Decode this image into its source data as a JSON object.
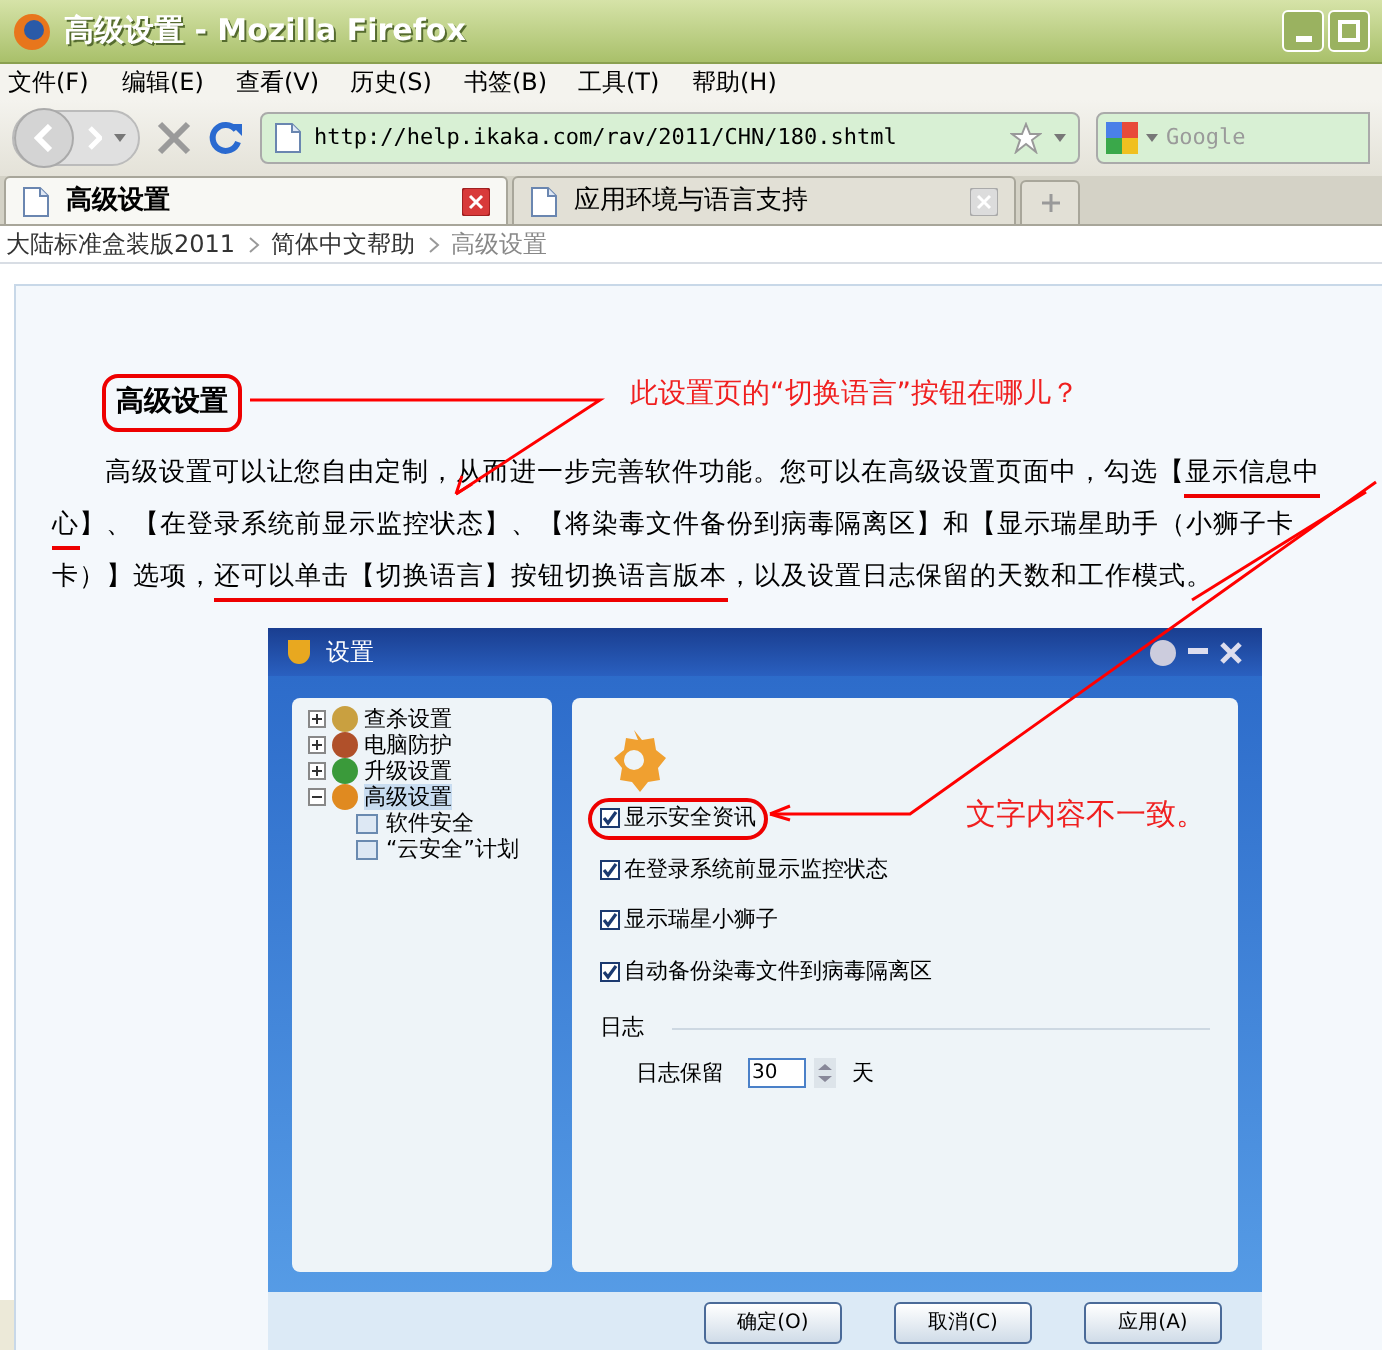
{
  "window": {
    "title": "高级设置 - Mozilla Firefox"
  },
  "menu": [
    "文件(F)",
    "编辑(E)",
    "查看(V)",
    "历史(S)",
    "书签(B)",
    "工具(T)",
    "帮助(H)"
  ],
  "toolbar": {
    "url": "http://help.ikaka.com/rav/2011/CHN/180.shtml",
    "search_placeholder": "Google"
  },
  "tabs": [
    {
      "label": "高级设置",
      "selected": true
    },
    {
      "label": "应用环境与语言支持",
      "selected": false
    }
  ],
  "breadcrumb": [
    {
      "label": "大陆标准盒装版2011",
      "current": false
    },
    {
      "label": "简体中文帮助",
      "current": false
    },
    {
      "label": "高级设置",
      "current": true
    }
  ],
  "article": {
    "heading": "高级设置",
    "paragraph": [
      {
        "text": "高级设置可以让您自由定制，从而进一步完善软件功能。您可以在高级设置页面中，勾选【",
        "underlined": false
      },
      {
        "text": "显示信息中心",
        "underlined": true
      },
      {
        "text": "】、【在登录系统前显示监控状态】、【将染毒文件备份到病毒隔离区】和【显示瑞星助手（小狮子卡卡）】选项，",
        "underlined": false
      },
      {
        "text": "还可以单击【切换语言】按钮切换语言版本",
        "underlined": true
      },
      {
        "text": "，以及设置日志保留的天数和工作模式。",
        "underlined": false
      }
    ]
  },
  "annotations": [
    "此设置页的“切换语言”按钮在哪儿？",
    "文字内容不一致。"
  ],
  "dialog": {
    "title": "设置",
    "tree": [
      {
        "label": "查杀设置",
        "expanded": false,
        "selected": false
      },
      {
        "label": "电脑防护",
        "expanded": false,
        "selected": false
      },
      {
        "label": "升级设置",
        "expanded": false,
        "selected": false
      },
      {
        "label": "高级设置",
        "expanded": true,
        "selected": true,
        "children": [
          {
            "label": "软件安全"
          },
          {
            "label": "“云安全”计划"
          }
        ]
      }
    ],
    "options": [
      {
        "label": "显示安全资讯",
        "checked": true,
        "highlighted": true
      },
      {
        "label": "在登录系统前显示监控状态",
        "checked": true,
        "highlighted": false
      },
      {
        "label": "显示瑞星小狮子",
        "checked": true,
        "highlighted": false
      },
      {
        "label": "自动备份染毒文件到病毒隔离区",
        "checked": true,
        "highlighted": false
      }
    ],
    "log_section": "日志",
    "log_label": "日志保留",
    "log_value": "30",
    "log_unit": "天",
    "buttons": [
      "确定(O)",
      "取消(C)",
      "应用(A)"
    ]
  }
}
